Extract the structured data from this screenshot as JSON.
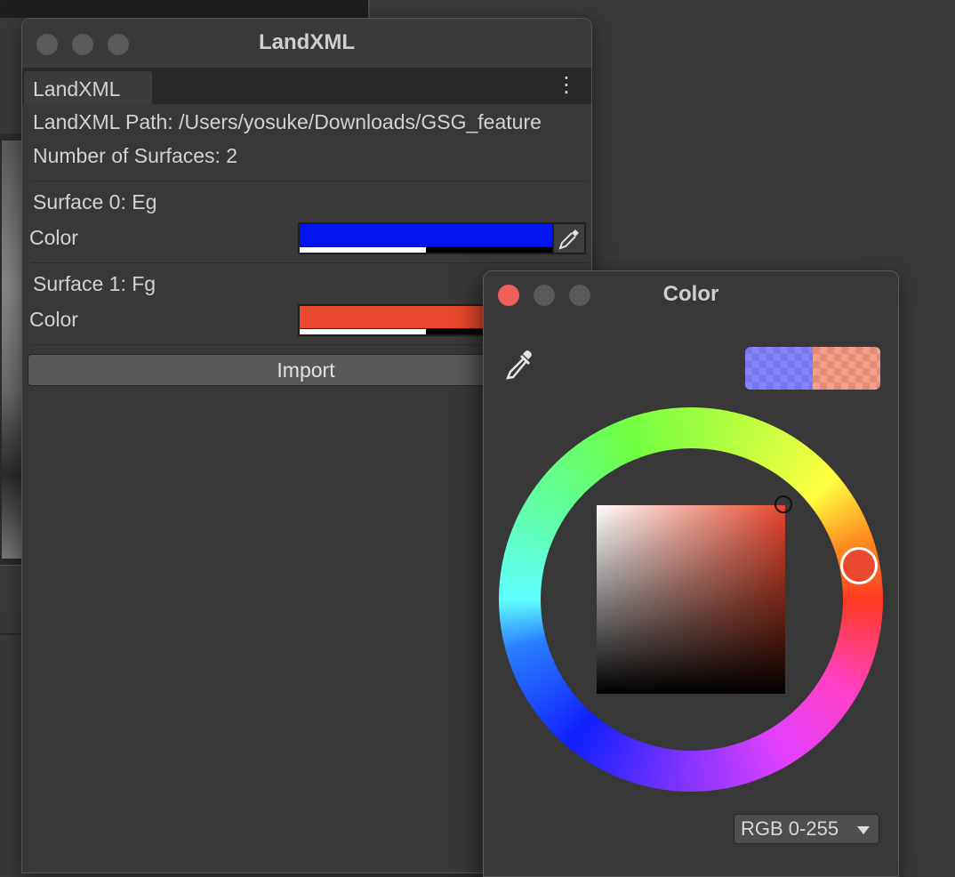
{
  "landxml_window": {
    "title": "LandXML",
    "tab_label": "LandXML",
    "path_label": "LandXML Path: /Users/yosuke/Downloads/GSG_feature",
    "surface_count_label": "Number of Surfaces: 2",
    "surfaces": [
      {
        "heading": "Surface 0: Eg",
        "color_label": "Color",
        "color": "#0015f0",
        "alpha_fraction": 0.5
      },
      {
        "heading": "Surface 1: Fg",
        "color_label": "Color",
        "color": "#ea4a2d",
        "alpha_fraction": 0.5
      }
    ],
    "import_label": "Import"
  },
  "color_window": {
    "title": "Color",
    "mode_label": "RGB 0-255",
    "preview_colors": [
      "#7676f3",
      "#e68c75"
    ],
    "current_color": "#ea4a2d"
  }
}
